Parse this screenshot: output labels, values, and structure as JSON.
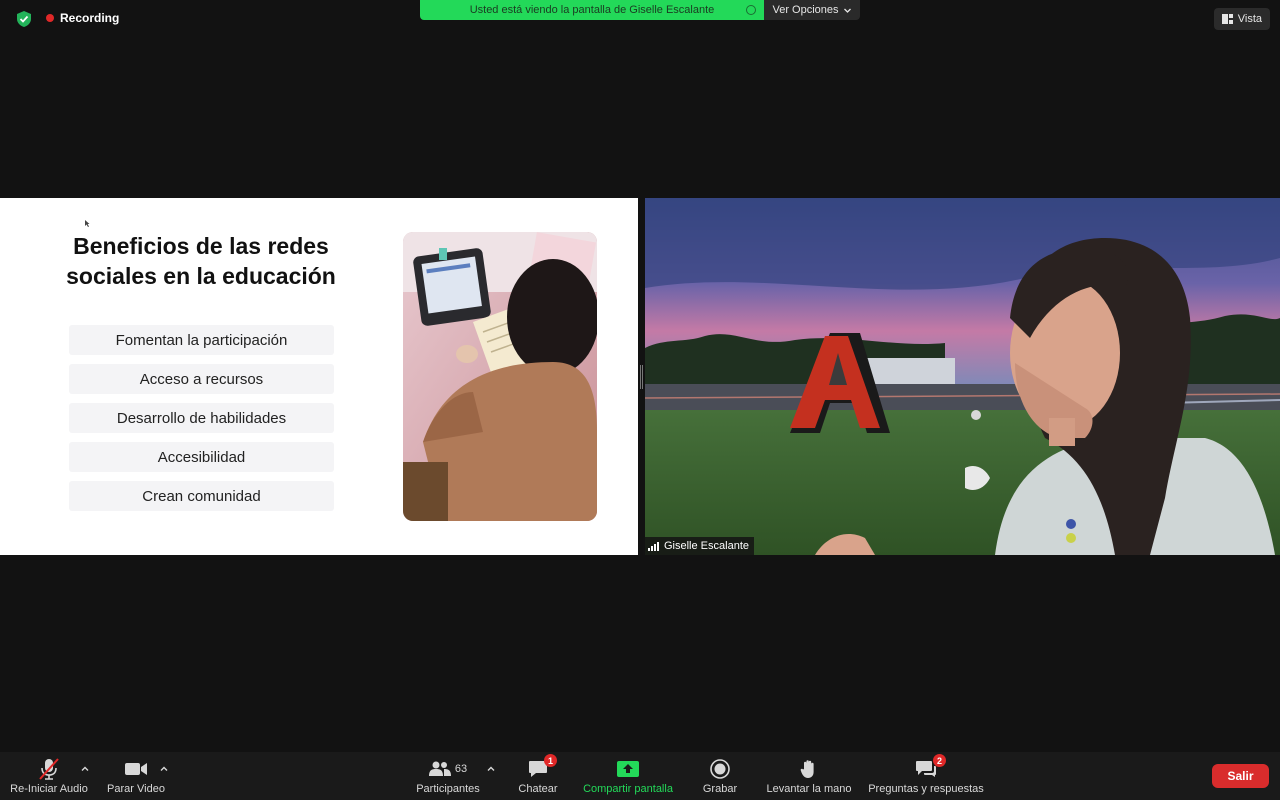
{
  "top": {
    "recording_label": "Recording",
    "share_banner": "Usted está viendo la pantalla de Giselle Escalante",
    "view_options": "Ver Opciones",
    "view_button": "Vista"
  },
  "slide": {
    "title": "Beneficios de las redes sociales en la educación",
    "items": [
      "Fomentan la participación",
      "Acceso a recursos",
      "Desarrollo de habilidades",
      "Accesibilidad",
      "Crean comunidad"
    ]
  },
  "camera": {
    "participant_name": "Giselle Escalante"
  },
  "toolbar": {
    "audio_label": "Re-Iniciar Audio",
    "video_label": "Parar Video",
    "participants_label": "Participantes",
    "participants_count": "63",
    "chat_label": "Chatear",
    "chat_badge": "1",
    "share_label": "Compartir pantalla",
    "record_label": "Grabar",
    "raise_hand_label": "Levantar la mano",
    "qa_label": "Preguntas y respuestas",
    "qa_badge": "2",
    "leave_label": "Salir"
  },
  "colors": {
    "accent_green": "#23d959",
    "danger_red": "#d92c2c",
    "background": "#121212"
  }
}
